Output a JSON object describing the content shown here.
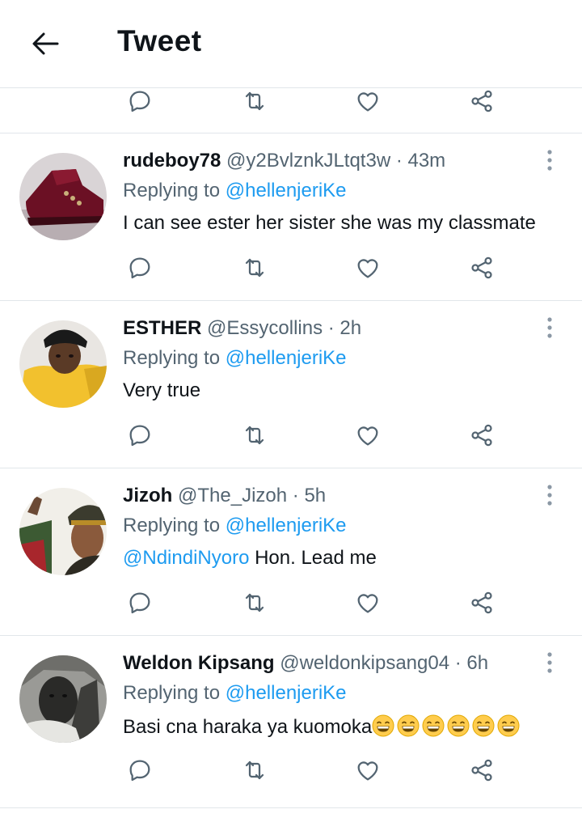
{
  "header": {
    "title": "Tweet",
    "back_icon": "arrow-left-icon"
  },
  "action_icons": [
    "reply-icon",
    "retweet-icon",
    "like-icon",
    "share-icon"
  ],
  "colors": {
    "link": "#1d9bf0",
    "secondary_text": "#536471",
    "primary_text": "#0f1419",
    "divider": "#e1e6ea"
  },
  "tweets": [
    {
      "name": "rudeboy78",
      "handle": "@y2BvlznkJLtqt3w",
      "time": "· 43m",
      "replying_label": "Replying to",
      "replying_to": "@hellenjeriKe",
      "mention": "",
      "text": "I can see ester her sister she was my classmate",
      "emoji_count": 0
    },
    {
      "name": "ESTHER",
      "handle": "@Essycollins",
      "time": "· 2h",
      "replying_label": "Replying to",
      "replying_to": "@hellenjeriKe",
      "mention": "",
      "text": "Very true",
      "emoji_count": 0
    },
    {
      "name": "Jizoh",
      "handle": "@The_Jizoh",
      "time": "· 5h",
      "replying_label": "Replying to",
      "replying_to": "@hellenjeriKe",
      "mention": "@NdindiNyoro",
      "text": " Hon. Lead me",
      "emoji_count": 0
    },
    {
      "name": "Weldon Kipsang",
      "handle": "@weldonkipsang04",
      "time": "· 6h",
      "replying_label": "Replying to",
      "replying_to": "@hellenjeriKe",
      "mention": "",
      "text": "Basi cna haraka ya kuomoka",
      "emoji_count": 6
    }
  ]
}
